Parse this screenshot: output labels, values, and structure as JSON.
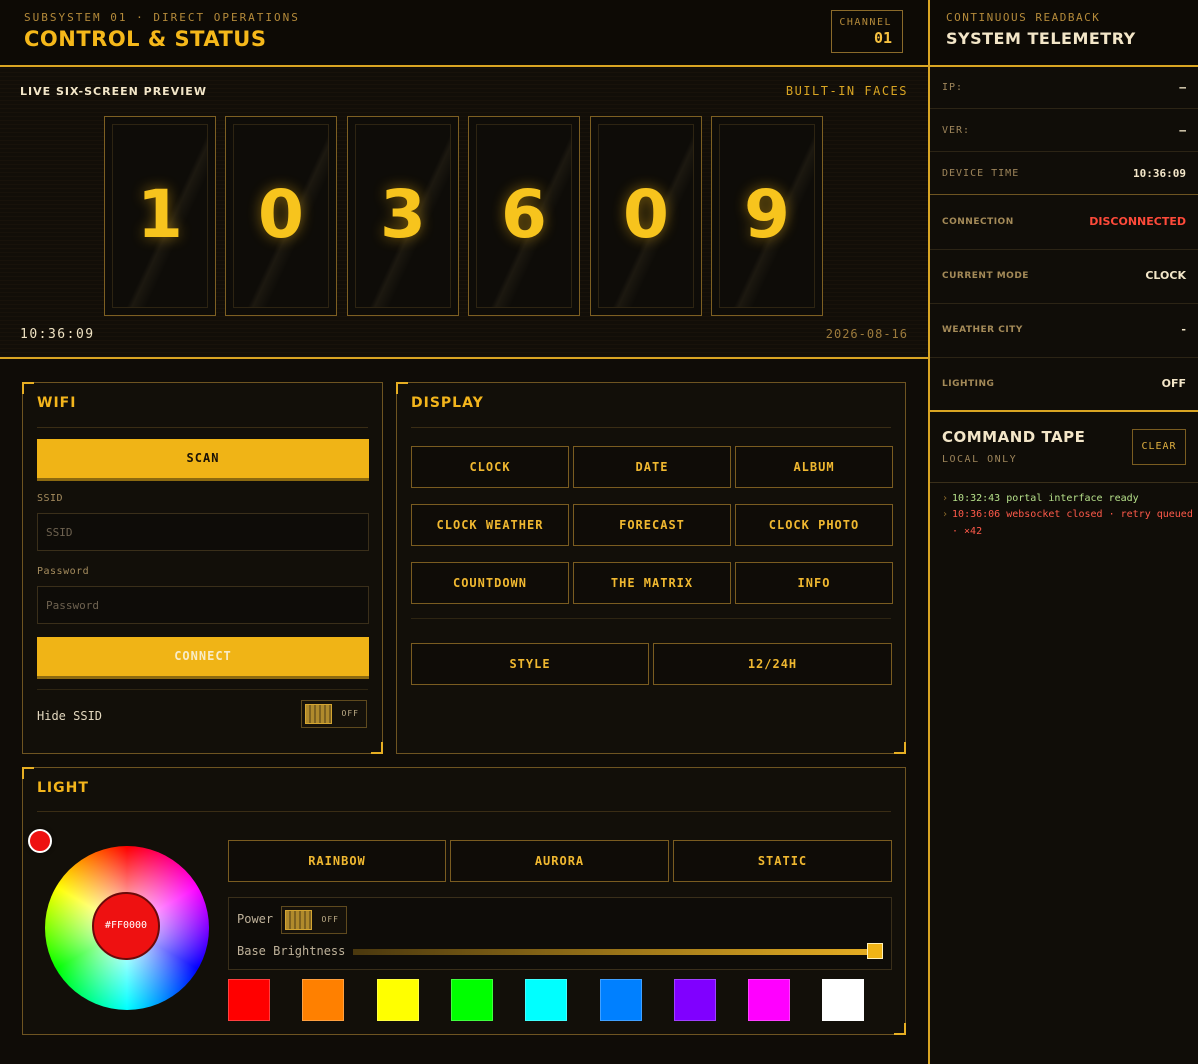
{
  "header": {
    "subtitle": "SUBSYSTEM 01 · DIRECT OPERATIONS",
    "title": "CONTROL & STATUS",
    "channel_label": "CHANNEL",
    "channel_value": "01"
  },
  "preview": {
    "title": "LIVE SIX-SCREEN PREVIEW",
    "faces_label": "BUILT-IN FACES",
    "digits": [
      "1",
      "0",
      "3",
      "6",
      "0",
      "9"
    ],
    "time": "10:36:09",
    "date": "2026-08-16"
  },
  "wifi": {
    "title": "WIFI",
    "scan_label": "SCAN",
    "ssid_label": "SSID",
    "ssid_placeholder": "SSID",
    "password_label": "Password",
    "password_placeholder": "Password",
    "connect_label": "CONNECT",
    "hide_ssid_label": "Hide SSID",
    "hide_ssid_state": "OFF"
  },
  "display": {
    "title": "DISPLAY",
    "modes": [
      "CLOCK",
      "DATE",
      "ALBUM",
      "CLOCK WEATHER",
      "FORECAST",
      "CLOCK PHOTO",
      "COUNTDOWN",
      "THE MATRIX",
      "INFO"
    ],
    "style_label": "STYLE",
    "format_label": "12/24H"
  },
  "light": {
    "title": "LIGHT",
    "color_value": "#FF0000",
    "effects": [
      "RAINBOW",
      "AURORA",
      "STATIC"
    ],
    "power_label": "Power",
    "power_state": "OFF",
    "brightness_label": "Base Brightness",
    "brightness": 1.0,
    "swatches": [
      "#ff0000",
      "#ff8000",
      "#ffff00",
      "#00ff00",
      "#00ffff",
      "#0080ff",
      "#8000ff",
      "#ff00ff",
      "#ffffff"
    ]
  },
  "telemetry": {
    "subtitle": "CONTINUOUS READBACK",
    "title": "SYSTEM TELEMETRY",
    "ip_label": "IP:",
    "ip_value": "—",
    "ver_label": "VER:",
    "ver_value": "—",
    "device_time_label": "DEVICE TIME",
    "device_time_value": "10:36:09",
    "connection_label": "CONNECTION",
    "connection_value": "DISCONNECTED",
    "mode_label": "CURRENT MODE",
    "mode_value": "CLOCK",
    "city_label": "WEATHER CITY",
    "city_value": "-",
    "lighting_label": "LIGHTING",
    "lighting_value": "OFF"
  },
  "tape": {
    "title": "COMMAND TAPE",
    "subtitle": "LOCAL ONLY",
    "clear_label": "CLEAR",
    "entries": [
      {
        "text": "10:32:43 portal interface ready",
        "color": "#b6e08a"
      },
      {
        "text": "10:36:06 websocket closed · retry queued · ×42",
        "color": "#ff5a4a"
      }
    ]
  },
  "colors": {
    "accent": "#f0b416",
    "disconnected": "#ff4a3a"
  }
}
